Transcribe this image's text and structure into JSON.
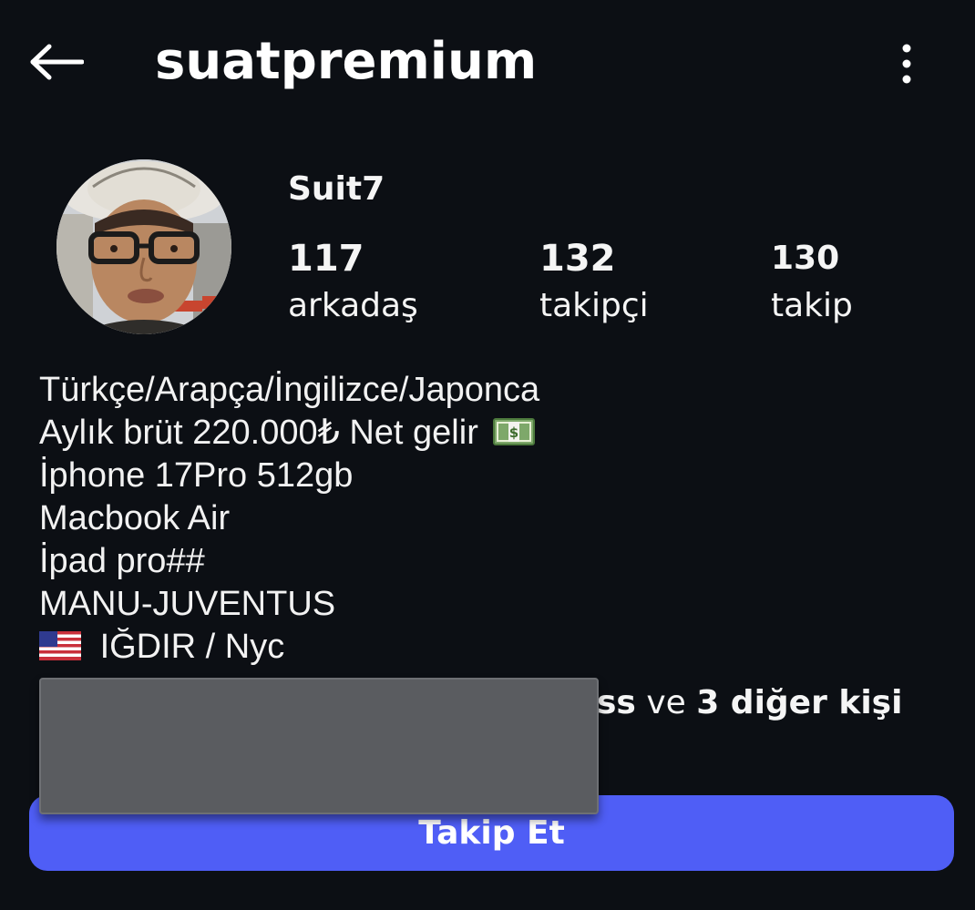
{
  "header": {
    "username": "suatpremium",
    "back_icon": "arrow-left-icon",
    "more_icon": "more-vertical-icon"
  },
  "profile": {
    "display_name": "Suit7",
    "stats": [
      {
        "value": "117",
        "label": "arkadaş"
      },
      {
        "value": "132",
        "label": "takipçi"
      },
      {
        "value": "130",
        "label": "takip"
      }
    ]
  },
  "bio": {
    "lines": [
      "Türkçe/Arapça/İngilizce/Japonca",
      "Aylık brüt 220.000₺ Net gelir",
      "İphone 17Pro 512gb",
      "Macbook Air",
      "İpad pro##",
      "MANU-JUVENTUS",
      "IĞDIR / Nyc"
    ],
    "bill_icon": "dollar-banknote-icon",
    "flag_icon": "us-flag-icon"
  },
  "mutuals": {
    "name_fragment": "ss",
    "connector": "ve",
    "others": "3 diğer kişi"
  },
  "actions": {
    "follow_label": "Takip Et"
  },
  "colors": {
    "background": "#0c0f14",
    "accent": "#4f5ef6",
    "redaction": "#5a5c60"
  }
}
